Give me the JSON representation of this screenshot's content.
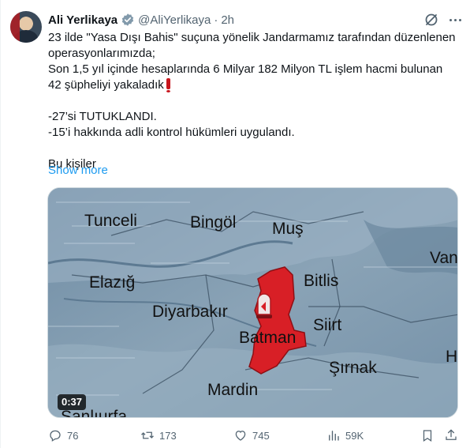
{
  "author": {
    "name": "Ali Yerlikaya",
    "handle": "@AliYerlikaya",
    "separator": "·",
    "time": "2h"
  },
  "tweet": {
    "line1": "23 ilde \"Yasa Dışı Bahis\" suçuna yönelik Jandarmamız tarafından düzenlenen operasyonlarımızda;",
    "line2": "Son 1,5 yıl içinde hesaplarında 6 Milyar 182 Milyon TL işlem hacmi bulunan 42 şüpheliyi yakaladık",
    "line3": "-27’si TUTUKLANDI.",
    "line4": "-15’i hakkında adli kontrol hükümleri uygulandı.",
    "line5": "Bu kişiler",
    "show_more": "Show more"
  },
  "media": {
    "duration": "0:37",
    "map_labels": {
      "tunceli": "Tunceli",
      "bingol": "Bingöl",
      "mus": "Muş",
      "van": "Van",
      "elazig": "Elazığ",
      "bitlis": "Bitlis",
      "diyarbakir": "Diyarbakır",
      "siirt": "Siirt",
      "batman": "Batman",
      "sirnak": "Şırnak",
      "hakkari": "H",
      "mardin": "Mardin",
      "sanliurfa": "Şanlıurfa"
    },
    "highlight_color": "#d81f26",
    "background_color": "#7e98ad"
  },
  "actions": {
    "replies": "76",
    "reposts": "173",
    "likes": "745",
    "views": "59K"
  },
  "icons": {
    "verified": "verified-badge-icon",
    "grok": "grok-icon",
    "more": "more-icon",
    "reply": "reply-icon",
    "repost": "repost-icon",
    "like": "like-icon",
    "views": "views-icon",
    "bookmark": "bookmark-icon",
    "share": "share-icon"
  }
}
